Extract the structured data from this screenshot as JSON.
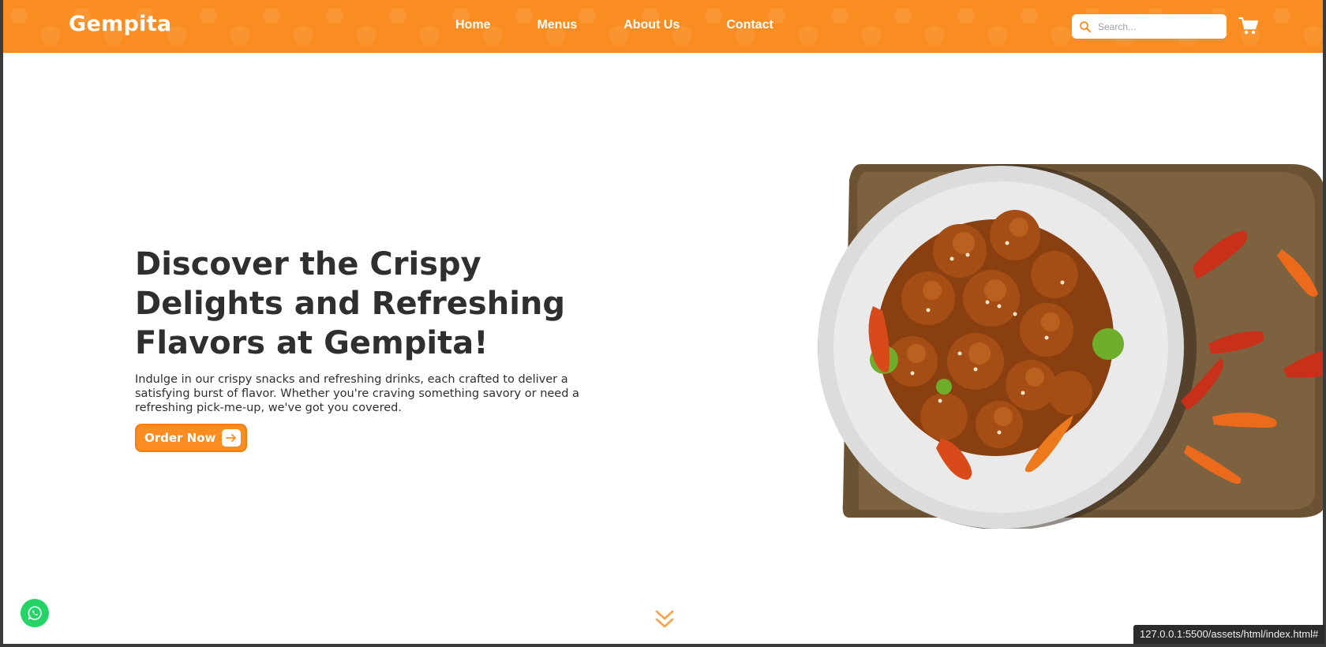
{
  "header": {
    "logo": "Gempita",
    "nav": [
      {
        "label": "Home"
      },
      {
        "label": "Menus"
      },
      {
        "label": "About Us"
      },
      {
        "label": "Contact"
      }
    ],
    "search_placeholder": "Search..."
  },
  "hero": {
    "title_line1": "Discover the Crispy",
    "title_line2": "Delights and Refreshing",
    "title_line3": "Flavors at ",
    "title_brand": "Gempita!",
    "description": "Indulge in our crispy snacks and refreshing drinks, each crafted to deliver a satisfying burst of flavor. Whether you're craving something savory or need a refreshing pick-me-up, we've got you covered.",
    "cta_label": "Order Now"
  },
  "status_bar": {
    "url": "127.0.0.1:5500/assets/html/index.html#"
  },
  "colors": {
    "brand_orange": "#f98d22",
    "text_dark": "#2f2f2f",
    "whatsapp_green": "#25d366"
  },
  "icons": [
    "search-icon",
    "cart-icon",
    "arrow-right-icon",
    "chevron-double-down-icon",
    "whatsapp-icon"
  ]
}
